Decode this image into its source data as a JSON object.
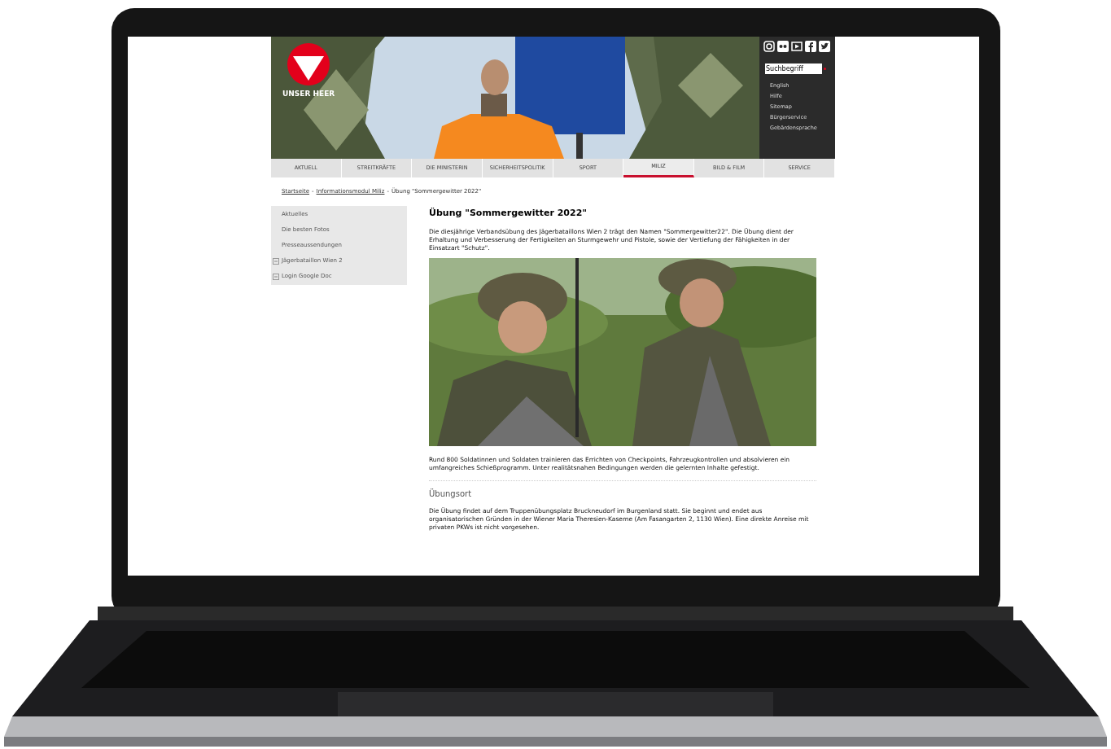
{
  "header": {
    "logo_text": "UNSER HEER",
    "search": {
      "placeholder": "Suchbegriff"
    },
    "links": [
      "English",
      "Hilfe",
      "Sitemap",
      "Bürgerservice",
      "Gebärdensprache"
    ]
  },
  "nav": {
    "tabs": [
      {
        "label": "AKTUELL",
        "selected": false
      },
      {
        "label": "STREITKRÄFTE",
        "selected": false
      },
      {
        "label": "DIE MINISTERIN",
        "selected": false
      },
      {
        "label": "SICHERHEITSPOLITIK",
        "selected": false
      },
      {
        "label": "SPORT",
        "selected": false
      },
      {
        "label": "MILIZ",
        "selected": true
      },
      {
        "label": "BILD & FILM",
        "selected": false
      },
      {
        "label": "SERVICE",
        "selected": false
      }
    ]
  },
  "breadcrumb": [
    {
      "label": "Startseite",
      "kind": "link"
    },
    {
      "label": "-",
      "kind": "separator"
    },
    {
      "label": "Informationsmodul Miliz",
      "kind": "link"
    },
    {
      "label": "-",
      "kind": "separator"
    },
    {
      "label": "Übung \"Sommergewitter 2022\"",
      "kind": "current"
    }
  ],
  "sidebar": {
    "items": [
      {
        "label": "Aktuelles",
        "expandable": false
      },
      {
        "label": "Die besten Fotos",
        "expandable": false
      },
      {
        "label": "Presseaussendungen",
        "expandable": false
      },
      {
        "label": "Jägerbataillon Wien 2",
        "expandable": true
      },
      {
        "label": "Login Google Doc",
        "expandable": true
      }
    ]
  },
  "article": {
    "title": "Übung \"Sommergewitter 2022\"",
    "intro": "Die diesjährige Verbandsübung des Jägerbataillons Wien 2 trägt den Namen \"Sommergewitter22\". Die Übung dient der Erhaltung und Verbesserung der Fertigkeiten an Sturmgewehr und Pistole, sowie der Vertiefung der Fähigkeiten in der Einsatzart \"Schutz\".",
    "body": "Rund 800 Soldatinnen und Soldaten trainieren das Errichten von Checkpoints, Fahrzeugkontrollen und absolvieren ein umfangreiches Schießprogramm. Unter realitätsnahen Bedingungen werden die gelernten Inhalte gefestigt.",
    "section_heading": "Übungsort",
    "section_text": "Die Übung findet auf dem Truppenübungsplatz Bruckneudorf im Burgenland statt. Sie beginnt und endet aus organisatorischen Gründen in der Wiener Maria Theresien-Kaserne (Am Fasangarten 2, 1130 Wien). Eine direkte Anreise mit privaten PKWs ist nicht vorgesehen."
  }
}
